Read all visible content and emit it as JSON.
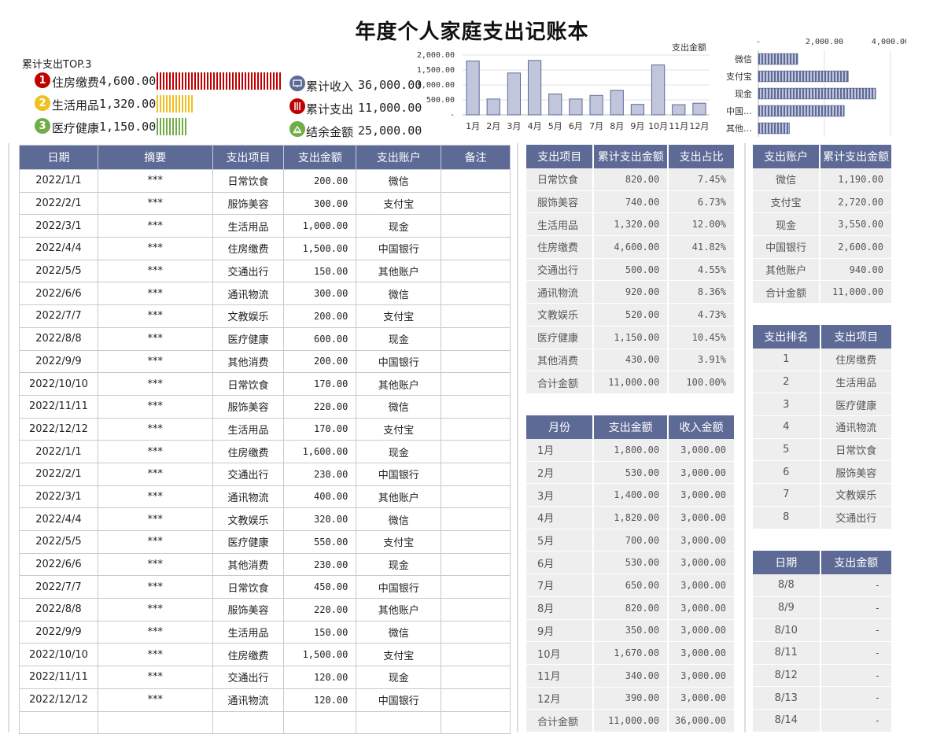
{
  "title": "年度个人家庭支出记账本",
  "top3": {
    "heading": "累计支出TOP.3",
    "items": [
      {
        "rank": "1",
        "name": "住房缴费",
        "amount": "4,600.00",
        "color": "#c00000",
        "bar_fraction": 1.0
      },
      {
        "rank": "2",
        "name": "生活用品",
        "amount": "1,320.00",
        "color": "#f0c020",
        "bar_fraction": 0.29
      },
      {
        "rank": "3",
        "name": "医疗健康",
        "amount": "1,150.00",
        "color": "#70ad47",
        "bar_fraction": 0.25
      }
    ]
  },
  "kpis": [
    {
      "icon": "monitor-icon",
      "label": "累计收入",
      "value": "36,000.00",
      "color": "#5e6a96"
    },
    {
      "icon": "equalizer-icon",
      "label": "累计支出",
      "value": "11,000.00",
      "color": "#c00000"
    },
    {
      "icon": "scale-icon",
      "label": "结余金额",
      "value": "25,000.00",
      "color": "#70ad47"
    }
  ],
  "chart_data": [
    {
      "type": "bar",
      "title": "支出金额",
      "categories": [
        "1月",
        "2月",
        "3月",
        "4月",
        "5月",
        "6月",
        "7月",
        "8月",
        "9月",
        "10月",
        "11月",
        "12月"
      ],
      "values": [
        1800,
        530,
        1400,
        1820,
        700,
        530,
        650,
        820,
        350,
        1670,
        340,
        390
      ],
      "yticks": [
        "-",
        "500.00",
        "1,000.00",
        "1,500.00",
        "2,000.00"
      ],
      "ylim": [
        0,
        2000
      ],
      "bar_color": "#c2c6dd",
      "bar_edge": "#5e6a96",
      "grid": true
    },
    {
      "type": "bar",
      "orientation": "horizontal",
      "categories": [
        "微信",
        "支付宝",
        "现金",
        "中国…",
        "其他…"
      ],
      "values": [
        1190,
        2720,
        3550,
        2600,
        940
      ],
      "xticks": [
        "-",
        "2,000.00",
        "4,000.00"
      ],
      "xlim": [
        0,
        4000
      ],
      "bar_color": "#5e6a96",
      "grid": true
    }
  ],
  "ledger": {
    "headers": [
      "日期",
      "摘要",
      "支出项目",
      "支出金额",
      "支出账户",
      "备注"
    ],
    "rows": [
      [
        "2022/1/1",
        "***",
        "日常饮食",
        "200.00",
        "微信",
        ""
      ],
      [
        "2022/2/1",
        "***",
        "服饰美容",
        "300.00",
        "支付宝",
        ""
      ],
      [
        "2022/3/1",
        "***",
        "生活用品",
        "1,000.00",
        "现金",
        ""
      ],
      [
        "2022/4/4",
        "***",
        "住房缴费",
        "1,500.00",
        "中国银行",
        ""
      ],
      [
        "2022/5/5",
        "***",
        "交通出行",
        "150.00",
        "其他账户",
        ""
      ],
      [
        "2022/6/6",
        "***",
        "通讯物流",
        "300.00",
        "微信",
        ""
      ],
      [
        "2022/7/7",
        "***",
        "文教娱乐",
        "200.00",
        "支付宝",
        ""
      ],
      [
        "2022/8/8",
        "***",
        "医疗健康",
        "600.00",
        "现金",
        ""
      ],
      [
        "2022/9/9",
        "***",
        "其他消费",
        "200.00",
        "中国银行",
        ""
      ],
      [
        "2022/10/10",
        "***",
        "日常饮食",
        "170.00",
        "其他账户",
        ""
      ],
      [
        "2022/11/11",
        "***",
        "服饰美容",
        "220.00",
        "微信",
        ""
      ],
      [
        "2022/12/12",
        "***",
        "生活用品",
        "170.00",
        "支付宝",
        ""
      ],
      [
        "2022/1/1",
        "***",
        "住房缴费",
        "1,600.00",
        "现金",
        ""
      ],
      [
        "2022/2/1",
        "***",
        "交通出行",
        "230.00",
        "中国银行",
        ""
      ],
      [
        "2022/3/1",
        "***",
        "通讯物流",
        "400.00",
        "其他账户",
        ""
      ],
      [
        "2022/4/4",
        "***",
        "文教娱乐",
        "320.00",
        "微信",
        ""
      ],
      [
        "2022/5/5",
        "***",
        "医疗健康",
        "550.00",
        "支付宝",
        ""
      ],
      [
        "2022/6/6",
        "***",
        "其他消费",
        "230.00",
        "现金",
        ""
      ],
      [
        "2022/7/7",
        "***",
        "日常饮食",
        "450.00",
        "中国银行",
        ""
      ],
      [
        "2022/8/8",
        "***",
        "服饰美容",
        "220.00",
        "其他账户",
        ""
      ],
      [
        "2022/9/9",
        "***",
        "生活用品",
        "150.00",
        "微信",
        ""
      ],
      [
        "2022/10/10",
        "***",
        "住房缴费",
        "1,500.00",
        "支付宝",
        ""
      ],
      [
        "2022/11/11",
        "***",
        "交通出行",
        "120.00",
        "现金",
        ""
      ],
      [
        "2022/12/12",
        "***",
        "通讯物流",
        "120.00",
        "中国银行",
        ""
      ],
      [
        "",
        "",
        "",
        "",
        "",
        ""
      ]
    ]
  },
  "category_summary": {
    "headers": [
      "支出项目",
      "累计支出金额",
      "支出占比"
    ],
    "rows": [
      [
        "日常饮食",
        "820.00",
        "7.45%"
      ],
      [
        "服饰美容",
        "740.00",
        "6.73%"
      ],
      [
        "生活用品",
        "1,320.00",
        "12.00%"
      ],
      [
        "住房缴费",
        "4,600.00",
        "41.82%"
      ],
      [
        "交通出行",
        "500.00",
        "4.55%"
      ],
      [
        "通讯物流",
        "920.00",
        "8.36%"
      ],
      [
        "文教娱乐",
        "520.00",
        "4.73%"
      ],
      [
        "医疗健康",
        "1,150.00",
        "10.45%"
      ],
      [
        "其他消费",
        "430.00",
        "3.91%"
      ],
      [
        "合计金额",
        "11,000.00",
        "100.00%"
      ]
    ]
  },
  "monthly_summary": {
    "headers": [
      "月份",
      "支出金额",
      "收入金额"
    ],
    "rows": [
      [
        "1月",
        "1,800.00",
        "3,000.00"
      ],
      [
        "2月",
        "530.00",
        "3,000.00"
      ],
      [
        "3月",
        "1,400.00",
        "3,000.00"
      ],
      [
        "4月",
        "1,820.00",
        "3,000.00"
      ],
      [
        "5月",
        "700.00",
        "3,000.00"
      ],
      [
        "6月",
        "530.00",
        "3,000.00"
      ],
      [
        "7月",
        "650.00",
        "3,000.00"
      ],
      [
        "8月",
        "820.00",
        "3,000.00"
      ],
      [
        "9月",
        "350.00",
        "3,000.00"
      ],
      [
        "10月",
        "1,670.00",
        "3,000.00"
      ],
      [
        "11月",
        "340.00",
        "3,000.00"
      ],
      [
        "12月",
        "390.00",
        "3,000.00"
      ],
      [
        "合计金额",
        "11,000.00",
        "36,000.00"
      ]
    ]
  },
  "account_summary": {
    "headers": [
      "支出账户",
      "累计支出金额"
    ],
    "rows": [
      [
        "微信",
        "1,190.00"
      ],
      [
        "支付宝",
        "2,720.00"
      ],
      [
        "现金",
        "3,550.00"
      ],
      [
        "中国银行",
        "2,600.00"
      ],
      [
        "其他账户",
        "940.00"
      ],
      [
        "合计金额",
        "11,000.00"
      ]
    ]
  },
  "ranking": {
    "headers": [
      "支出排名",
      "支出项目"
    ],
    "rows": [
      [
        "1",
        "住房缴费"
      ],
      [
        "2",
        "生活用品"
      ],
      [
        "3",
        "医疗健康"
      ],
      [
        "4",
        "通讯物流"
      ],
      [
        "5",
        "日常饮食"
      ],
      [
        "6",
        "服饰美容"
      ],
      [
        "7",
        "文教娱乐"
      ],
      [
        "8",
        "交通出行"
      ]
    ]
  },
  "daily": {
    "headers": [
      "日期",
      "支出金额"
    ],
    "rows": [
      [
        "8/8",
        "-"
      ],
      [
        "8/9",
        "-"
      ],
      [
        "8/10",
        "-"
      ],
      [
        "8/11",
        "-"
      ],
      [
        "8/12",
        "-"
      ],
      [
        "8/13",
        "-"
      ],
      [
        "8/14",
        "-"
      ]
    ]
  }
}
